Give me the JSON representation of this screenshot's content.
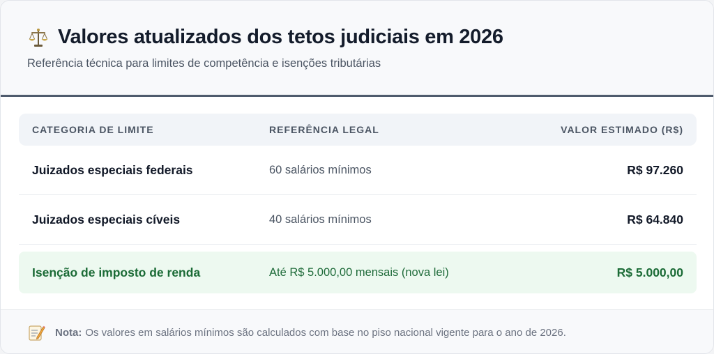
{
  "header": {
    "icon": "balance-scale-icon",
    "title": "Valores atualizados dos tetos judiciais em 2026",
    "subtitle": "Referência técnica para limites de competência e isenções tributárias"
  },
  "table": {
    "columns": [
      "CATEGORIA DE LIMITE",
      "REFERÊNCIA LEGAL",
      "VALOR ESTIMADO (R$)"
    ],
    "rows": [
      {
        "category": "Juizados especiais federais",
        "reference": "60 salários mínimos",
        "value": "R$ 97.260",
        "highlight": false
      },
      {
        "category": "Juizados especiais cíveis",
        "reference": "40 salários mínimos",
        "value": "R$ 64.840",
        "highlight": false
      },
      {
        "category": "Isenção de imposto de renda",
        "reference": "Até R$ 5.000,00 mensais (nova lei)",
        "value": "R$ 5.000,00",
        "highlight": true
      }
    ]
  },
  "footer": {
    "icon": "memo-icon",
    "label": "Nota:",
    "text": "Os valores em salários mínimos são calculados com base no piso nacional vigente para o ano de 2026."
  },
  "colors": {
    "header_border": "#4f5b6d",
    "highlight_bg": "#edf9f0",
    "highlight_text": "#1b6b36"
  }
}
